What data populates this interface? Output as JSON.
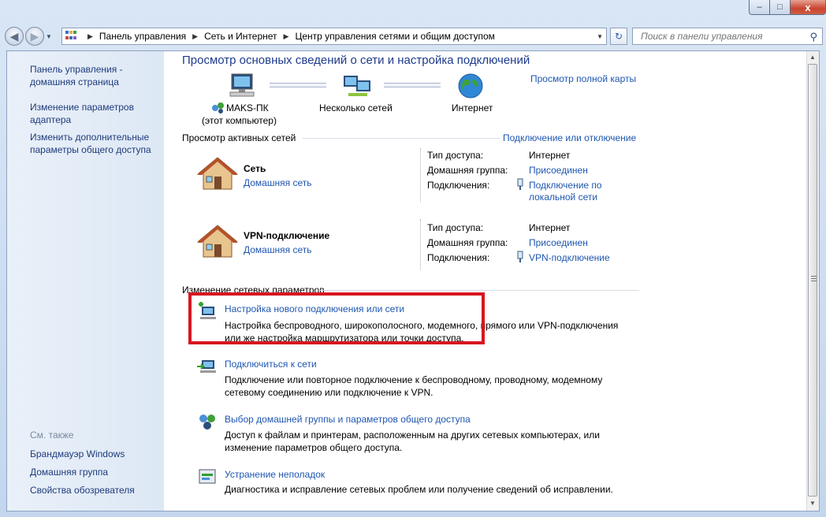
{
  "window": {
    "caption_buttons": {
      "minimize": "–",
      "maximize": "□",
      "close": "x"
    }
  },
  "navbar": {
    "breadcrumbs": [
      "Панель управления",
      "Сеть и Интернет",
      "Центр управления сетями и общим доступом"
    ],
    "search_placeholder": "Поиск в панели управления"
  },
  "sidebar": {
    "home_line1": "Панель управления -",
    "home_line2": "домашняя страница",
    "adapter_line1": "Изменение параметров",
    "adapter_line2": "адаптера",
    "sharing_line1": "Изменить дополнительные",
    "sharing_line2": "параметры общего доступа",
    "see_also": "См. также",
    "see_also_items": [
      "Брандмауэр Windows",
      "Домашняя группа",
      "Свойства обозревателя"
    ]
  },
  "main": {
    "title": "Просмотр основных сведений о сети и настройка подключений",
    "full_map": "Просмотр полной карты",
    "map": {
      "pc_name": "MAKS-ПК",
      "pc_sub": "(этот компьютер)",
      "networks": "Несколько сетей",
      "internet": "Интернет"
    },
    "active_header": "Просмотр активных сетей",
    "connect_disconnect": "Подключение или отключение",
    "net1": {
      "name": "Сеть",
      "type": "Домашняя сеть",
      "access_label": "Тип доступа:",
      "access_value": "Интернет",
      "group_label": "Домашняя группа:",
      "group_value": "Присоединен",
      "conn_label": "Подключения:",
      "conn_value_line1": "Подключение по",
      "conn_value_line2": "локальной сети"
    },
    "net2": {
      "name": "VPN-подключение",
      "type": "Домашняя сеть",
      "access_label": "Тип доступа:",
      "access_value": "Интернет",
      "group_label": "Домашняя группа:",
      "group_value": "Присоединен",
      "conn_label": "Подключения:",
      "conn_value": "VPN-подключение"
    },
    "change_header": "Изменение сетевых параметров",
    "tasks": [
      {
        "title": "Настройка нового подключения или сети",
        "desc1": "Настройка беспроводного, широкополосного, модемного, прямого или VPN-подключения",
        "desc2": "или же настройка маршрутизатора или точки доступа."
      },
      {
        "title": "Подключиться к сети",
        "desc1": "Подключение или повторное подключение к беспроводному, проводному, модемному",
        "desc2": "сетевому соединению или подключение к VPN."
      },
      {
        "title": "Выбор домашней группы и параметров общего доступа",
        "desc1": "Доступ к файлам и принтерам, расположенным на других сетевых компьютерах, или",
        "desc2": "изменение параметров общего доступа."
      },
      {
        "title": "Устранение неполадок",
        "desc1": "Диагностика и исправление сетевых проблем или получение сведений об исправлении."
      }
    ]
  }
}
